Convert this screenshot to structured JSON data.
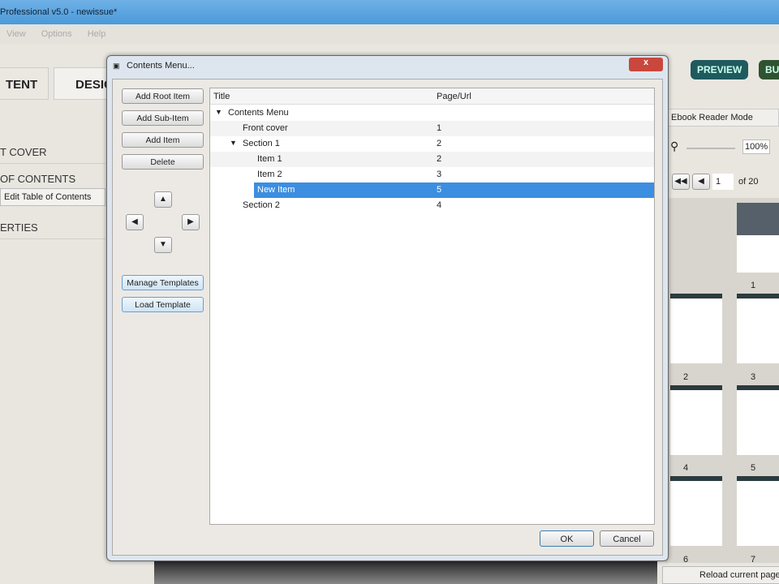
{
  "app": {
    "title": "Professional v5.0 - newissue*",
    "menu": [
      "View",
      "Options",
      "Help"
    ]
  },
  "tabs": [
    "TENT",
    "DESIG"
  ],
  "sidebar": {
    "items": [
      "T COVER",
      "OF CONTENTS",
      "ERTIES"
    ],
    "edit_button": "Edit Table of Contents"
  },
  "right": {
    "preview": "PREVIEW",
    "build": "BU",
    "mode": "Ebook Reader Mode",
    "zoom": "100%",
    "page": "1",
    "of": "of 20",
    "reload": "Reload current page",
    "pages": [
      "1",
      "2",
      "3",
      "4",
      "5",
      "6",
      "7"
    ]
  },
  "dialog": {
    "title": "Contents Menu...",
    "close": "x",
    "buttons": {
      "add_root": "Add Root Item",
      "add_sub": "Add Sub-Item",
      "add_item": "Add Item",
      "delete": "Delete",
      "manage": "Manage Templates",
      "load": "Load Template",
      "ok": "OK",
      "cancel": "Cancel"
    },
    "columns": [
      "Title",
      "Page/Url"
    ],
    "rows": [
      {
        "title": "Contents Menu",
        "page": ""
      },
      {
        "title": "Front cover",
        "page": "1"
      },
      {
        "title": "Section 1",
        "page": "2"
      },
      {
        "title": "Item 1",
        "page": "2"
      },
      {
        "title": "Item 2",
        "page": "3"
      },
      {
        "title": "New Item",
        "page": "5"
      },
      {
        "title": "Section 2",
        "page": "4"
      }
    ]
  }
}
